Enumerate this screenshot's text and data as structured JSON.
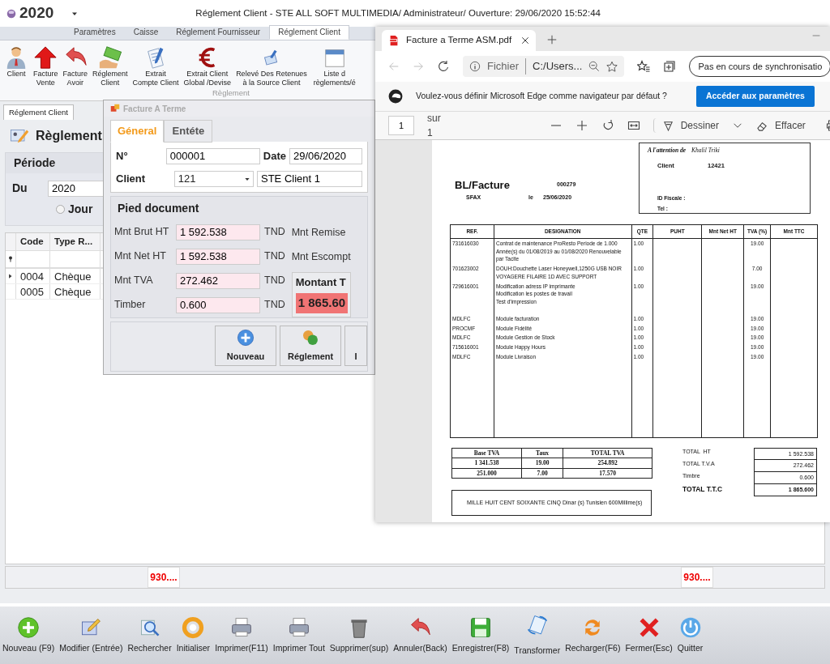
{
  "app": {
    "year": "2020",
    "title": "Réglement Client - STE ALL SOFT MULTIMEDIA/ Administrateur/ Ouverture: 29/06/2020 15:52:44"
  },
  "ribbon": {
    "tabs": [
      {
        "label": "Paramètres",
        "selected": false
      },
      {
        "label": "Caisse",
        "selected": false
      },
      {
        "label": "Réglement Fournisseur",
        "selected": false
      },
      {
        "label": "Réglement Client",
        "selected": true
      }
    ],
    "buttons": [
      {
        "label": "Client"
      },
      {
        "label": "Facture\nVente"
      },
      {
        "label": "Facture\nAvoir"
      },
      {
        "label": "Réglement\nClient"
      },
      {
        "label": "Extrait\nCompte Client"
      },
      {
        "label": "Extrait Client\nGlobal /Devise"
      },
      {
        "label": "Relevé Des Retenues\nà la Source Client"
      },
      {
        "label": "Liste d\nrèglements/é"
      }
    ],
    "group": "Règlement"
  },
  "workspace": {
    "doc_tab": "Réglement Client",
    "header": "Règlement",
    "periode": {
      "title": "Période",
      "from_label": "Du",
      "from_value": "2020",
      "option": {
        "label": "Jour",
        "selected": false
      }
    },
    "grid": {
      "columns": [
        "Code",
        "Type R..."
      ],
      "rows": [
        {
          "cells": [
            "0004",
            "Chèque"
          ],
          "current": true
        },
        {
          "cells": [
            "0005",
            "Chèque"
          ],
          "current": false
        }
      ]
    },
    "totals": [
      "930....",
      "930...."
    ]
  },
  "dialog": {
    "title": "Facture A Terme",
    "tabs": [
      {
        "label": "Géneral",
        "selected": true
      },
      {
        "label": "Entéte",
        "selected": false
      }
    ],
    "number": {
      "label": "N°",
      "value": "000001"
    },
    "date": {
      "label": "Date",
      "value": "29/06/2020"
    },
    "client": {
      "label": "Client",
      "code": "121",
      "name": "STE Client 1"
    },
    "section": "Pied document",
    "amounts": [
      {
        "label": "Mnt Brut HT",
        "value": "1 592.538",
        "currency": "TND"
      },
      {
        "label": "Mnt Net HT",
        "value": "1 592.538",
        "currency": "TND"
      },
      {
        "label": "Mnt TVA",
        "value": "272.462",
        "currency": "TND"
      },
      {
        "label": "Timber",
        "value": "0.600",
        "currency": "TND"
      }
    ],
    "side_labels": [
      "Mnt Remise",
      "Mnt Escompt"
    ],
    "total": {
      "label": "Montant T",
      "value": "1 865.60"
    },
    "buttons": [
      "Nouveau",
      "Réglement",
      "I"
    ]
  },
  "browser": {
    "tab": "Facture a Terme ASM.pdf",
    "address": {
      "scheme": "Fichier",
      "path": "C:/Users..."
    },
    "sync": "Pas en cours de synchronisatio",
    "banner": {
      "text": "Voulez-vous définir Microsoft Edge comme navigateur par défaut ?",
      "button": "Accéder aux paramètres"
    },
    "pdf": {
      "page": "1",
      "of": "sur 1",
      "draw": "Dessiner",
      "erase": "Effacer"
    }
  },
  "invoice": {
    "attention_label": "A l'attention de",
    "attention_name": "Khalil Triki",
    "client_label": "Client",
    "client_code": "12421",
    "fiscal_label": "ID Fiscale :",
    "tel_label": "Tel :",
    "title": "BL/Facture",
    "number": "000279",
    "city": "SFAX",
    "date_prefix": "le",
    "date": "25/06/2020",
    "columns": [
      "REF.",
      "DESIGNATION",
      "QTE",
      "PUHT",
      "Mnt Net HT",
      "TVA (%)",
      "Mnt TTC"
    ],
    "lines": [
      {
        "ref": "731616030",
        "designation": "Contrat de maintenance ProResto Periode de 1.000 Année(s) du 01/08/2019 au 01/08/2020 Renouvelable par Tacite",
        "qte": "1.00",
        "tva": "19.00"
      },
      {
        "ref": "701623002",
        "designation": "DOUH:Douchette Laser Honeywell,1250G USB NOIR VOYAGERE  FILAIRE 1D AVEC SUPPORT",
        "qte": "1.00",
        "tva": "7.00"
      },
      {
        "ref": "729616001",
        "designation": "Modification adress IP imprimante\nModification les postes de travail\nTest d'impression",
        "qte": "1.00",
        "tva": "19.00"
      },
      {
        "ref": "MDLFC",
        "designation": "Module facturation",
        "qte": "1.00",
        "tva": "19.00"
      },
      {
        "ref": "PROCMF",
        "designation": "Module Fidélité",
        "qte": "1.00",
        "tva": "19.00"
      },
      {
        "ref": "MDLFC",
        "designation": "Module Gestion de Stock",
        "qte": "1.00",
        "tva": "19.00"
      },
      {
        "ref": "715616001",
        "designation": "Module Happy Hours",
        "qte": "1.00",
        "tva": "19.00"
      },
      {
        "ref": "MDLFC",
        "designation": "Module Livraison",
        "qte": "1.00",
        "tva": "19.00"
      }
    ],
    "vat_table": {
      "columns": [
        "Base TVA",
        "Taux",
        "TOTAL TVA"
      ],
      "rows": [
        [
          "1 341.538",
          "19.00",
          "254.892"
        ],
        [
          "251.000",
          "7.00",
          "17.570"
        ]
      ]
    },
    "totals": [
      {
        "label": "TOTAL  HT",
        "value": "1 592.538",
        "grand": false
      },
      {
        "label": "TOTAL T.V.A",
        "value": "272.462",
        "grand": false
      },
      {
        "label": "Timbre",
        "value": "0.600",
        "grand": false
      },
      {
        "label": "TOTAL T.T.C",
        "value": "1 865.600",
        "grand": true
      }
    ],
    "amount_words": "MILLE HUIT CENT SOIXANTE CINQ Dinar (s) Tunisien  600Millime(s)"
  },
  "toolbar": [
    "Nouveau (F9)",
    "Modifier (Entrée)",
    "Rechercher",
    "Initialiser",
    "Imprimer(F11)",
    "Imprimer Tout",
    "Supprimer(sup)",
    "Annuler(Back)",
    "Enregistrer(F8)",
    "Transformer",
    "Recharger(F6)",
    "Fermer(Esc)",
    "Quitter"
  ]
}
